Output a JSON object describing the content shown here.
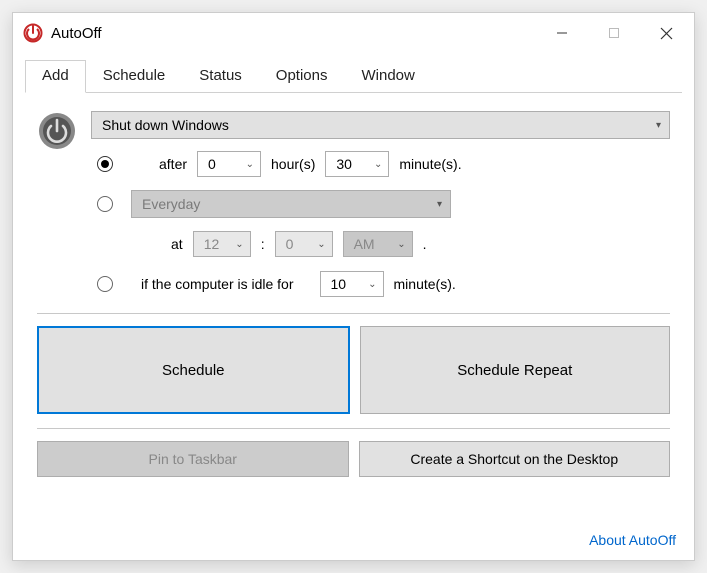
{
  "window": {
    "title": "AutoOff"
  },
  "tabs": {
    "add": "Add",
    "schedule": "Schedule",
    "status": "Status",
    "options": "Options",
    "window": "Window"
  },
  "action": {
    "selected": "Shut down Windows"
  },
  "options": {
    "after": {
      "label_after": "after",
      "hours_value": "0",
      "hours_label": "hour(s)",
      "minutes_value": "30",
      "minutes_label": "minute(s)."
    },
    "everyday": {
      "label": "Everyday",
      "at_label": "at",
      "hour": "12",
      "colon": ":",
      "minute": "0",
      "ampm": "AM",
      "dot": "."
    },
    "idle": {
      "label_pre": "if the computer is idle for",
      "minutes_value": "10",
      "minutes_label": "minute(s)."
    }
  },
  "buttons": {
    "schedule": "Schedule",
    "schedule_repeat": "Schedule Repeat",
    "pin_taskbar": "Pin to Taskbar",
    "create_shortcut": "Create a Shortcut on the Desktop"
  },
  "footer": {
    "about": "About AutoOff"
  }
}
